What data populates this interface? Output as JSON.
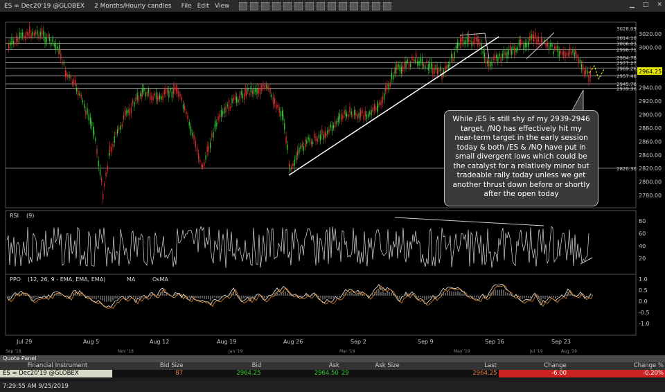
{
  "window": {
    "title": "ES ∞ Dec20'19 @GLOBEX",
    "interval": "2 Months/Hourly candles",
    "menus": [
      "File",
      "Edit",
      "View"
    ]
  },
  "price_axis": {
    "labels": [
      "3028.09",
      "3020.00",
      "3014.10",
      "3006.03",
      "3000.00",
      "2996.71",
      "2984.78",
      "2977.27",
      "2969.26",
      "2964.25",
      "2957.48",
      "2945.78",
      "2939.30",
      "2940.00",
      "2920.00",
      "2900.00",
      "2880.00",
      "2860.00",
      "2840.00",
      "2820.30",
      "2820.00",
      "2800.00",
      "2780.00"
    ],
    "current": "2964.25"
  },
  "callout": {
    "text": "While /ES is still shy of my 2939-2946 target, /NQ has effectively hit my near-term target in the early session today & both /ES & /NQ have put in small divergent lows which could be the catalyst for a relatively minor but tradeable rally today unless we get another thrust down before or shortly after the open today"
  },
  "rsi": {
    "label": "RSI",
    "period": "(9)",
    "ticks": [
      "80",
      "60",
      "40",
      "20"
    ]
  },
  "ppo": {
    "label": "PPO",
    "params": "(12, 26, 9 - EMA, EMA, EMA)",
    "ma_label": "MA",
    "osma_label": "OsMA",
    "ticks": [
      "1.0",
      "0.5",
      "0.0",
      "-0.5",
      "-1.0"
    ]
  },
  "time_axis": {
    "labels": [
      "Jul 29",
      "Aug 5",
      "Aug 12",
      "Aug 19",
      "Aug 26",
      "Sep 2",
      "Sep 9",
      "Sep 16",
      "Sep 23"
    ],
    "sub_labels": [
      "Sep '18",
      "Nov '18",
      "Jan '19",
      "Mar '19",
      "May '19",
      "Jul '19",
      "Aug '19"
    ]
  },
  "quote_panel": {
    "title": "Quote Panel",
    "headers": [
      "Financial Instrument",
      "Bid Size",
      "Bid",
      "Ask",
      "Ask Size",
      "Last",
      "Change",
      "Change %"
    ],
    "row": {
      "instrument": "ES ∞ Dec20'19 @GLOBEX",
      "bid_size": "87",
      "bid": "2964.25",
      "ask": "2964.50",
      "ask_size": "29",
      "last": "2964.25",
      "change": "-6.00",
      "change_pct": "-0.20%"
    }
  },
  "status": {
    "timestamp": "7:29:55 AM 9/25/2019"
  },
  "colors": {
    "up": "#2ecc2e",
    "down": "#e03030",
    "bg": "#000000",
    "negative_cell": "#cc2222"
  }
}
